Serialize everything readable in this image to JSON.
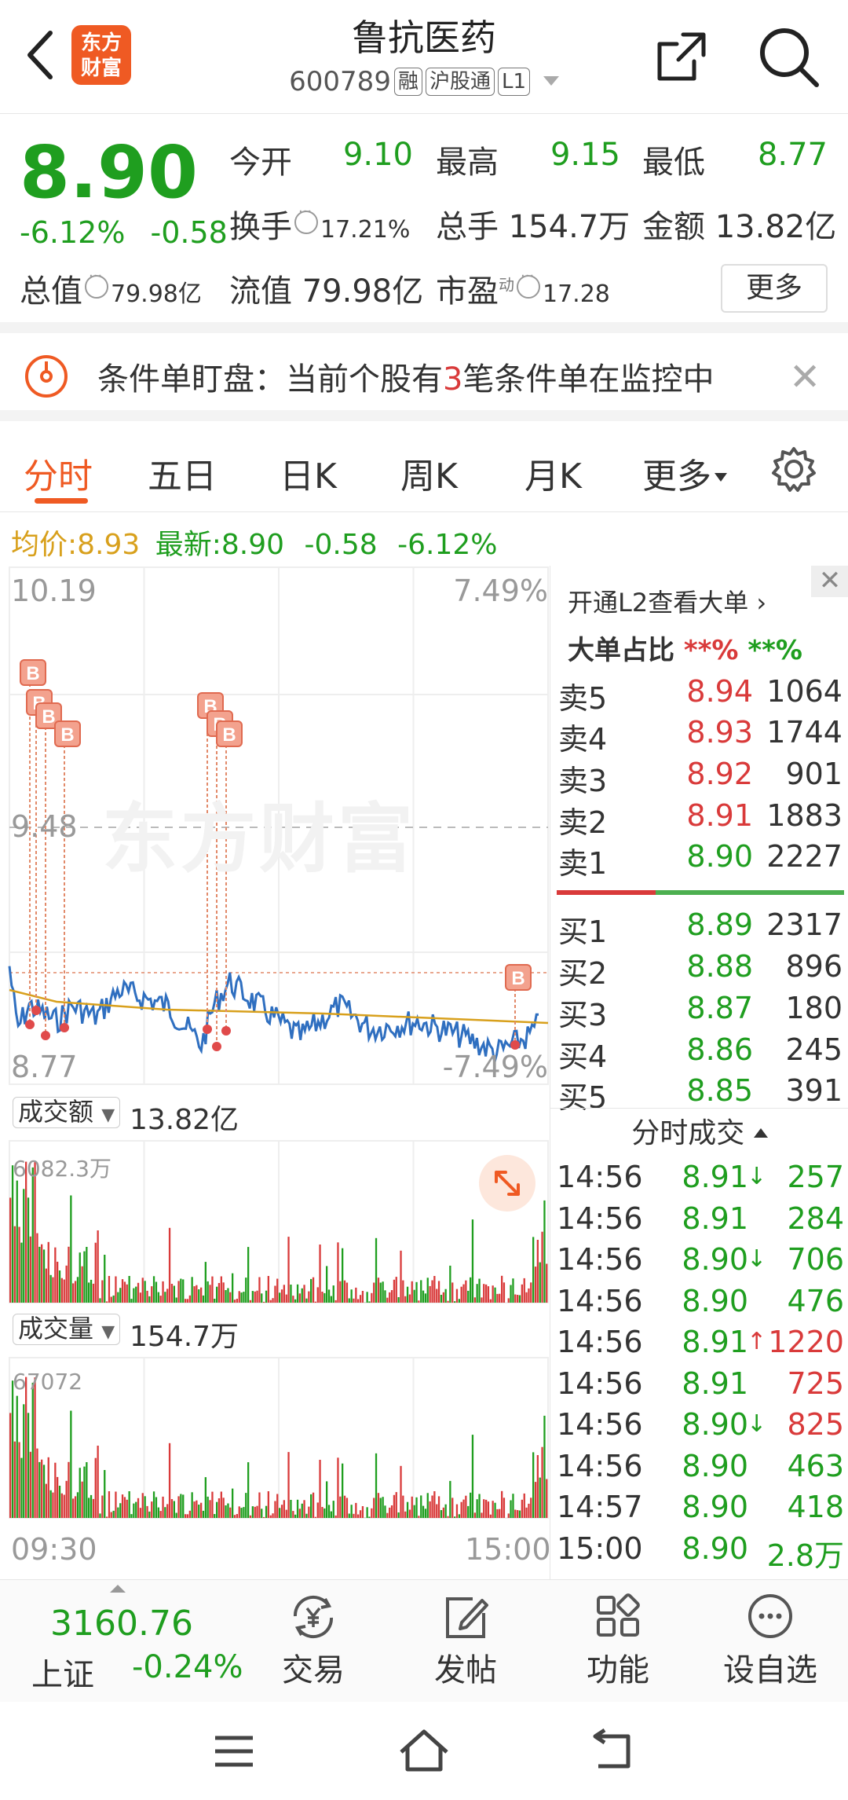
{
  "header": {
    "logo_text_1": "东方",
    "logo_text_2": "财富",
    "title": "鲁抗医药",
    "code": "600789",
    "tags": [
      "融",
      "沪股通",
      "L1"
    ]
  },
  "quote": {
    "price": "8.90",
    "change_pct": "-6.12%",
    "change": "-0.58",
    "open_label": "今开",
    "open": "9.10",
    "high_label": "最高",
    "high": "9.15",
    "low_label": "最低",
    "low": "8.77",
    "turnover_label": "换手",
    "turnover": "17.21%",
    "volume_label": "总手",
    "volume": "154.7万",
    "amount_label": "金额",
    "amount": "13.82亿",
    "mcap_label": "总值",
    "mcap": "79.98亿",
    "float_label": "流值",
    "float": "79.98亿",
    "pe_label": "市盈",
    "pe_sup": "动",
    "pe": "17.28",
    "more": "更多"
  },
  "banner": {
    "text_pre": "条件单盯盘：当前个股有",
    "count": "3",
    "text_post": "笔条件单在监控中"
  },
  "tabs": [
    "分时",
    "五日",
    "日K",
    "周K",
    "月K",
    "更多"
  ],
  "avgline": {
    "avg_label": "均价:",
    "avg": "8.93",
    "last_label": "最新:",
    "last": "8.90",
    "chg": "-0.58",
    "pct": "-6.12%"
  },
  "chart": {
    "y_max": "10.19",
    "pct_max": "7.49%",
    "y_ref": "9.48",
    "y_min": "8.77",
    "pct_min": "-7.49%",
    "watermark": "东方财富",
    "amount_btn": "成交额",
    "amount_total": "13.82亿",
    "amount_max": "6082.3万",
    "vol_btn": "成交量",
    "vol_total": "154.7万",
    "vol_max": "67072",
    "t_start": "09:30",
    "t_end": "15:00",
    "marker_label": "B"
  },
  "side": {
    "l2_text": "开通L2查看大单",
    "big_ratio_label": "大单占比",
    "big_ratio_red": "**%",
    "big_ratio_green": "**%",
    "asks": [
      {
        "label": "卖5",
        "price": "8.94",
        "vol": "1064"
      },
      {
        "label": "卖4",
        "price": "8.93",
        "vol": "1744"
      },
      {
        "label": "卖3",
        "price": "8.92",
        "vol": "901"
      },
      {
        "label": "卖2",
        "price": "8.91",
        "vol": "1883"
      },
      {
        "label": "卖1",
        "price": "8.90",
        "vol": "2227"
      }
    ],
    "bids": [
      {
        "label": "买1",
        "price": "8.89",
        "vol": "2317"
      },
      {
        "label": "买2",
        "price": "8.88",
        "vol": "896"
      },
      {
        "label": "买3",
        "price": "8.87",
        "vol": "180"
      },
      {
        "label": "买4",
        "price": "8.86",
        "vol": "245"
      },
      {
        "label": "买5",
        "price": "8.85",
        "vol": "391"
      }
    ],
    "ticks_header": "分时成交",
    "ticks": [
      {
        "time": "14:56",
        "price": "8.91",
        "arrow": "↓",
        "vol": "257",
        "vc": "green"
      },
      {
        "time": "14:56",
        "price": "8.91",
        "arrow": "",
        "vol": "284",
        "vc": "green"
      },
      {
        "time": "14:56",
        "price": "8.90",
        "arrow": "↓",
        "vol": "706",
        "vc": "green"
      },
      {
        "time": "14:56",
        "price": "8.90",
        "arrow": "",
        "vol": "476",
        "vc": "green"
      },
      {
        "time": "14:56",
        "price": "8.91",
        "arrow": "↑",
        "vol": "1220",
        "vc": "red"
      },
      {
        "time": "14:56",
        "price": "8.91",
        "arrow": "",
        "vol": "725",
        "vc": "red"
      },
      {
        "time": "14:56",
        "price": "8.90",
        "arrow": "↓",
        "vol": "825",
        "vc": "red"
      },
      {
        "time": "14:56",
        "price": "8.90",
        "arrow": "",
        "vol": "463",
        "vc": "green"
      },
      {
        "time": "14:57",
        "price": "8.90",
        "arrow": "",
        "vol": "418",
        "vc": "green"
      },
      {
        "time": "15:00",
        "price": "8.90",
        "arrow": "",
        "vol": "2.8万",
        "vc": "green"
      }
    ]
  },
  "bottombar": {
    "index_value": "3160.76",
    "index_name": "上证",
    "index_chg": "-0.24%",
    "items": [
      "交易",
      "发帖",
      "功能",
      "设自选"
    ]
  },
  "colors": {
    "up": "#d93a3a",
    "down": "#1f9e1f",
    "avg": "#d8a01c",
    "accent": "#ef5a23",
    "line": "#2f6fc0"
  }
}
